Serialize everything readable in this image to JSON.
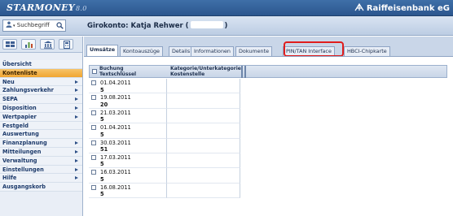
{
  "app": {
    "logo_text": "STARMONEY",
    "logo_version": "8.0",
    "bank_name": "Raiffeisenbank eG"
  },
  "search": {
    "value": "Suchbegriff"
  },
  "account": {
    "title_prefix": "Girokonto: Katja Rehwer (",
    "title_suffix": ")"
  },
  "sidebar": {
    "items": [
      {
        "label": "Übersicht",
        "arrow": false,
        "active": false
      },
      {
        "label": "Kontenliste",
        "arrow": false,
        "active": true
      },
      {
        "label": "Neu",
        "arrow": true,
        "active": false
      },
      {
        "label": "Zahlungsverkehr",
        "arrow": true,
        "active": false
      },
      {
        "label": "SEPA",
        "arrow": true,
        "active": false
      },
      {
        "label": "Disposition",
        "arrow": true,
        "active": false
      },
      {
        "label": "Wertpapier",
        "arrow": true,
        "active": false
      },
      {
        "label": "Festgeld",
        "arrow": false,
        "active": false
      },
      {
        "label": "Auswertung",
        "arrow": false,
        "active": false
      },
      {
        "label": "Finanzplanung",
        "arrow": true,
        "active": false
      },
      {
        "label": "Mitteilungen",
        "arrow": true,
        "active": false
      },
      {
        "label": "Verwaltung",
        "arrow": true,
        "active": false
      },
      {
        "label": "Einstellungen",
        "arrow": true,
        "active": false
      },
      {
        "label": "Hilfe",
        "arrow": true,
        "active": false
      },
      {
        "label": "Ausgangskorb",
        "arrow": false,
        "active": false
      }
    ]
  },
  "tabs": [
    {
      "label": "Umsätze",
      "active": true
    },
    {
      "label": "Kontoauszüge",
      "active": false
    },
    {
      "label": "Details",
      "active": false
    },
    {
      "label": "Informationen",
      "active": false
    },
    {
      "label": "Dokumente",
      "active": false
    },
    {
      "label": "PIN/TAN Interface",
      "active": false,
      "highlighted": true
    },
    {
      "label": "HBCI-Chipkarte",
      "active": false
    }
  ],
  "table": {
    "columns": [
      {
        "line1": "Buchung",
        "line2": "Textschlüssel"
      },
      {
        "line1": "Kategorie/Unterkategorie",
        "line2": "Kostenstelle"
      }
    ],
    "rows": [
      {
        "date": "01.04.2011",
        "key": "5"
      },
      {
        "date": "19.08.2011",
        "key": "20"
      },
      {
        "date": "21.03.2011",
        "key": "5"
      },
      {
        "date": "01.04.2011",
        "key": "5"
      },
      {
        "date": "30.03.2011",
        "key": "51"
      },
      {
        "date": "17.03.2011",
        "key": "5"
      },
      {
        "date": "16.03.2011",
        "key": "5"
      },
      {
        "date": "16.08.2011",
        "key": "5"
      }
    ]
  },
  "colors": {
    "banner": "#2b568e",
    "active_nav": "#f0a531",
    "highlight": "#e01d1d"
  }
}
